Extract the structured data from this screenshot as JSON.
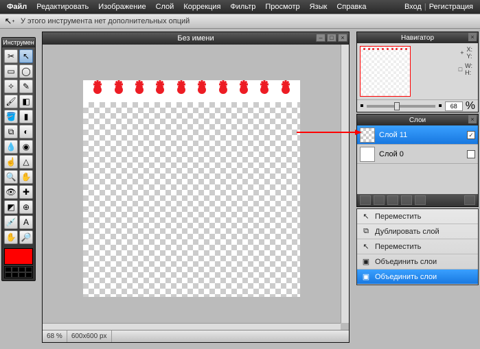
{
  "menu": {
    "items": [
      "Файл",
      "Редактировать",
      "Изображение",
      "Слой",
      "Коррекция",
      "Фильтр",
      "Просмотр",
      "Язык",
      "Справка"
    ],
    "login": "Вход",
    "register": "Регистрация"
  },
  "optbar": {
    "msg": "У этого инструмента нет дополнительных опций"
  },
  "toolbox": {
    "title": "Инструмен"
  },
  "doc": {
    "title": "Без имени",
    "zoom": "68",
    "zoom_unit": "%",
    "dims": "600x600 px"
  },
  "nav": {
    "title": "Навигатор",
    "x": "X:",
    "y": "Y:",
    "w": "W:",
    "h": "H:",
    "zoom": "68",
    "zoom_unit": "%"
  },
  "layers": {
    "title": "Слои",
    "rows": [
      {
        "name": "Слой 11",
        "checked": true,
        "selected": true
      },
      {
        "name": "Слой 0",
        "checked": false,
        "selected": false
      }
    ]
  },
  "ctx": {
    "items": [
      {
        "label": "Переместить",
        "icon": "↖",
        "sel": false
      },
      {
        "label": "Дублировать слой",
        "icon": "⧉",
        "sel": false
      },
      {
        "label": "Переместить",
        "icon": "↖",
        "sel": false
      },
      {
        "label": "Объединить слои",
        "icon": "▣",
        "sel": false
      },
      {
        "label": "Объединить слои",
        "icon": "▣",
        "sel": true
      }
    ]
  },
  "colors": {
    "fg": "#ff0000"
  }
}
